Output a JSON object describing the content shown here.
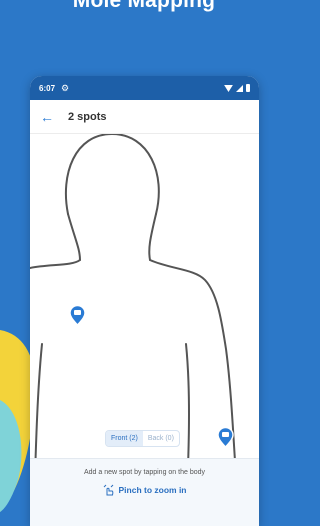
{
  "headline": "Mole Mapping",
  "colors": {
    "background": "#2c78c8",
    "statusbar": "#1d5fa8",
    "accent": "#2a7bd4"
  },
  "status_bar": {
    "time": "6:07",
    "settings_icon": "gear-icon",
    "icons": [
      "wifi-icon",
      "signal-icon",
      "battery-icon"
    ]
  },
  "app_bar": {
    "back_icon": "arrow-left-icon",
    "title": "2 spots"
  },
  "view_toggle": {
    "front_label": "Front (2)",
    "back_label": "Back (0)",
    "selected": "front"
  },
  "bottom_panel": {
    "hint": "Add a new spot by tapping on the body",
    "pinch_icon": "pinch-gesture-icon",
    "pinch_label": "Pinch to zoom in"
  },
  "spots": [
    {
      "icon": "mole-pin-icon"
    },
    {
      "icon": "mole-pin-icon"
    }
  ]
}
